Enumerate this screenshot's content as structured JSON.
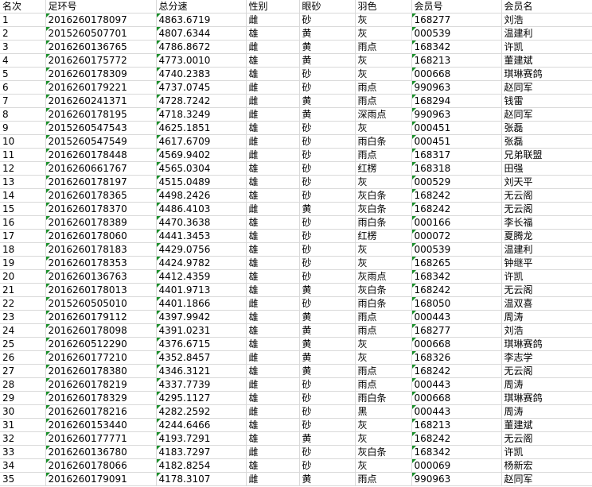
{
  "headers": [
    "名次",
    "足环号",
    "总分速",
    "性别",
    "眼砂",
    "羽色",
    "会员号",
    "会员名"
  ],
  "rows": [
    [
      "1",
      "2016260178097",
      "4863.6719",
      "雌",
      "砂",
      "灰",
      "168277",
      "刘浩"
    ],
    [
      "2",
      "2015260507701",
      "4807.6344",
      "雄",
      "黄",
      "灰",
      "000539",
      "温建利"
    ],
    [
      "3",
      "2016260136765",
      "4786.8672",
      "雌",
      "黄",
      "雨点",
      "168342",
      "许凯"
    ],
    [
      "4",
      "2016260175772",
      "4773.0010",
      "雄",
      "黄",
      "灰",
      "168213",
      "董建斌"
    ],
    [
      "5",
      "2016260178309",
      "4740.2383",
      "雄",
      "砂",
      "灰",
      "000668",
      "琪琳赛鸽"
    ],
    [
      "6",
      "2016260179221",
      "4737.0745",
      "雌",
      "砂",
      "雨点",
      "990963",
      "赵同军"
    ],
    [
      "7",
      "2016260241371",
      "4728.7242",
      "雌",
      "黄",
      "雨点",
      "168294",
      "钱雷"
    ],
    [
      "8",
      "2016260178195",
      "4718.3249",
      "雌",
      "黄",
      "深雨点",
      "990963",
      "赵同军"
    ],
    [
      "9",
      "2015260547543",
      "4625.1851",
      "雄",
      "砂",
      "灰",
      "000451",
      "张磊"
    ],
    [
      "10",
      "2015260547549",
      "4617.6709",
      "雌",
      "砂",
      "雨白条",
      "000451",
      "张磊"
    ],
    [
      "11",
      "2016260178448",
      "4569.9402",
      "雌",
      "砂",
      "雨点",
      "168317",
      "兄弟联盟"
    ],
    [
      "12",
      "2016260661767",
      "4565.0304",
      "雄",
      "砂",
      "红楞",
      "168318",
      "田强"
    ],
    [
      "13",
      "2016260178197",
      "4515.0489",
      "雄",
      "砂",
      "灰",
      "000529",
      "刘天平"
    ],
    [
      "14",
      "2016260178365",
      "4498.2426",
      "雄",
      "砂",
      "灰白条",
      "168242",
      "无云阁"
    ],
    [
      "15",
      "2016260178370",
      "4486.4103",
      "雌",
      "黄",
      "灰白条",
      "168242",
      "无云阁"
    ],
    [
      "16",
      "2016260178389",
      "4470.3638",
      "雄",
      "砂",
      "雨白条",
      "000166",
      "李长福"
    ],
    [
      "17",
      "2016260178060",
      "4441.3453",
      "雄",
      "砂",
      "红楞",
      "000072",
      "夏腾龙"
    ],
    [
      "18",
      "2016260178183",
      "4429.0756",
      "雄",
      "砂",
      "灰",
      "000539",
      "温建利"
    ],
    [
      "19",
      "2016260178353",
      "4424.9782",
      "雄",
      "砂",
      "灰",
      "168265",
      "钟继平"
    ],
    [
      "20",
      "2016260136763",
      "4412.4359",
      "雄",
      "砂",
      "灰雨点",
      "168342",
      "许凯"
    ],
    [
      "21",
      "2016260178013",
      "4401.9713",
      "雄",
      "黄",
      "灰白条",
      "168242",
      "无云阁"
    ],
    [
      "22",
      "2015260505010",
      "4401.1866",
      "雌",
      "砂",
      "雨白条",
      "168050",
      "温双喜"
    ],
    [
      "23",
      "2016260179112",
      "4397.9942",
      "雄",
      "黄",
      "雨点",
      "000443",
      "周涛"
    ],
    [
      "24",
      "2016260178098",
      "4391.0231",
      "雄",
      "黄",
      "雨点",
      "168277",
      "刘浩"
    ],
    [
      "25",
      "2016260512290",
      "4376.6715",
      "雄",
      "黄",
      "灰",
      "000668",
      "琪琳赛鸽"
    ],
    [
      "26",
      "2016260177210",
      "4352.8457",
      "雌",
      "黄",
      "灰",
      "168326",
      "李志学"
    ],
    [
      "27",
      "2016260178380",
      "4346.3121",
      "雄",
      "黄",
      "雨点",
      "168242",
      "无云阁"
    ],
    [
      "28",
      "2016260178219",
      "4337.7739",
      "雌",
      "砂",
      "雨点",
      "000443",
      "周涛"
    ],
    [
      "29",
      "2016260178329",
      "4295.1127",
      "雄",
      "砂",
      "雨白条",
      "000668",
      "琪琳赛鸽"
    ],
    [
      "30",
      "2016260178216",
      "4282.2592",
      "雌",
      "砂",
      "黑",
      "000443",
      "周涛"
    ],
    [
      "31",
      "2016260153440",
      "4244.6466",
      "雄",
      "砂",
      "灰",
      "168213",
      "董建斌"
    ],
    [
      "32",
      "2016260177771",
      "4193.7291",
      "雄",
      "黄",
      "灰",
      "168242",
      "无云阁"
    ],
    [
      "33",
      "2016260136780",
      "4183.7297",
      "雌",
      "砂",
      "灰白条",
      "168342",
      "许凯"
    ],
    [
      "34",
      "2016260178066",
      "4182.8254",
      "雄",
      "砂",
      "灰",
      "000069",
      "杨新宏"
    ],
    [
      "35",
      "2016260179091",
      "4178.3107",
      "雌",
      "黄",
      "雨点",
      "990963",
      "赵同军"
    ]
  ]
}
